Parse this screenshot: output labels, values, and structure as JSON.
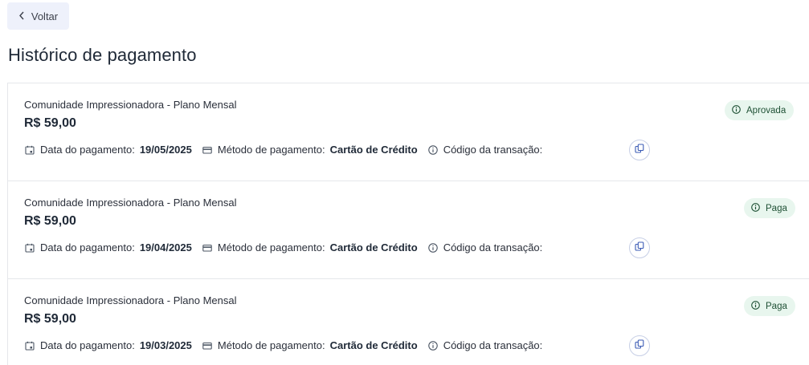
{
  "nav": {
    "back_label": "Voltar"
  },
  "page": {
    "title": "Histórico de pagamento"
  },
  "labels": {
    "date": "Data do pagamento:",
    "method": "Método de pagamento:",
    "transaction": "Código da transação:"
  },
  "colors": {
    "badge_bg": "#e8f6ee",
    "badge_text": "#1f5135",
    "back_bg": "#eef1fb",
    "copy_border": "#c7cfe6"
  },
  "payments": [
    {
      "plan": "Comunidade Impressionadora - Plano Mensal",
      "price": "R$ 59,00",
      "status": "Aprovada",
      "date": "19/05/2025",
      "method": "Cartão de Crédito"
    },
    {
      "plan": "Comunidade Impressionadora - Plano Mensal",
      "price": "R$ 59,00",
      "status": "Paga",
      "date": "19/04/2025",
      "method": "Cartão de Crédito"
    },
    {
      "plan": "Comunidade Impressionadora - Plano Mensal",
      "price": "R$ 59,00",
      "status": "Paga",
      "date": "19/03/2025",
      "method": "Cartão de Crédito"
    }
  ]
}
